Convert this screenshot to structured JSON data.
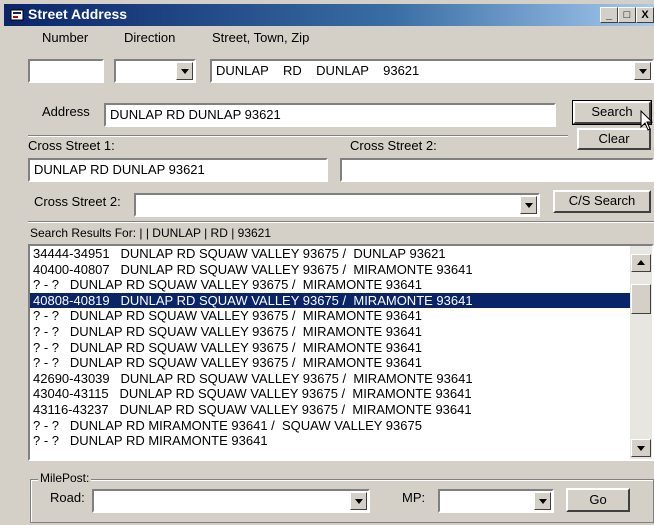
{
  "window": {
    "title": "Street Address",
    "controls": {
      "minimize": "_",
      "maximize": "□",
      "close": "X"
    }
  },
  "header_labels": {
    "number": "Number",
    "direction": "Direction",
    "street": "Street, Town, Zip"
  },
  "inputs": {
    "number_value": "",
    "direction_value": "",
    "street_value": "DUNLAP    RD    DUNLAP    93621"
  },
  "address": {
    "label": "Address",
    "value": "DUNLAP RD DUNLAP 93621"
  },
  "buttons": {
    "search": "Search",
    "clear": "Clear",
    "cs_search": "C/S Search",
    "go": "Go"
  },
  "cross_streets": {
    "label1": "Cross Street 1:",
    "value1": "DUNLAP RD DUNLAP 93621",
    "label2": "Cross Street 2:",
    "value2": "",
    "combo_label": "Cross Street 2:",
    "combo_value": ""
  },
  "results": {
    "header": "Search Results For:  |  | DUNLAP | RD | 93621",
    "selected_index": 3,
    "rows": [
      "34444-34951   DUNLAP RD SQUAW VALLEY 93675 /  DUNLAP 93621",
      "40400-40807   DUNLAP RD SQUAW VALLEY 93675 /  MIRAMONTE 93641",
      "? - ?   DUNLAP RD SQUAW VALLEY 93675 /  MIRAMONTE 93641",
      "40808-40819   DUNLAP RD SQUAW VALLEY 93675 /  MIRAMONTE 93641",
      "? - ?   DUNLAP RD SQUAW VALLEY 93675 /  MIRAMONTE 93641",
      "? - ?   DUNLAP RD SQUAW VALLEY 93675 /  MIRAMONTE 93641",
      "? - ?   DUNLAP RD SQUAW VALLEY 93675 /  MIRAMONTE 93641",
      "? - ?   DUNLAP RD SQUAW VALLEY 93675 /  MIRAMONTE 93641",
      "42690-43039   DUNLAP RD SQUAW VALLEY 93675 /  MIRAMONTE 93641",
      "43040-43115   DUNLAP RD SQUAW VALLEY 93675 /  MIRAMONTE 93641",
      "43116-43237   DUNLAP RD SQUAW VALLEY 93675 /  MIRAMONTE 93641",
      "? - ?   DUNLAP RD MIRAMONTE 93641 /  SQUAW VALLEY 93675",
      "? - ?   DUNLAP RD MIRAMONTE 93641"
    ]
  },
  "milepost": {
    "group_label": "MilePost:",
    "road_label": "Road:",
    "road_value": "",
    "mp_label": "MP:",
    "mp_value": ""
  },
  "colors": {
    "title_bar": "#0a246a",
    "selection": "#0a246a",
    "face": "#d4d0c8"
  }
}
